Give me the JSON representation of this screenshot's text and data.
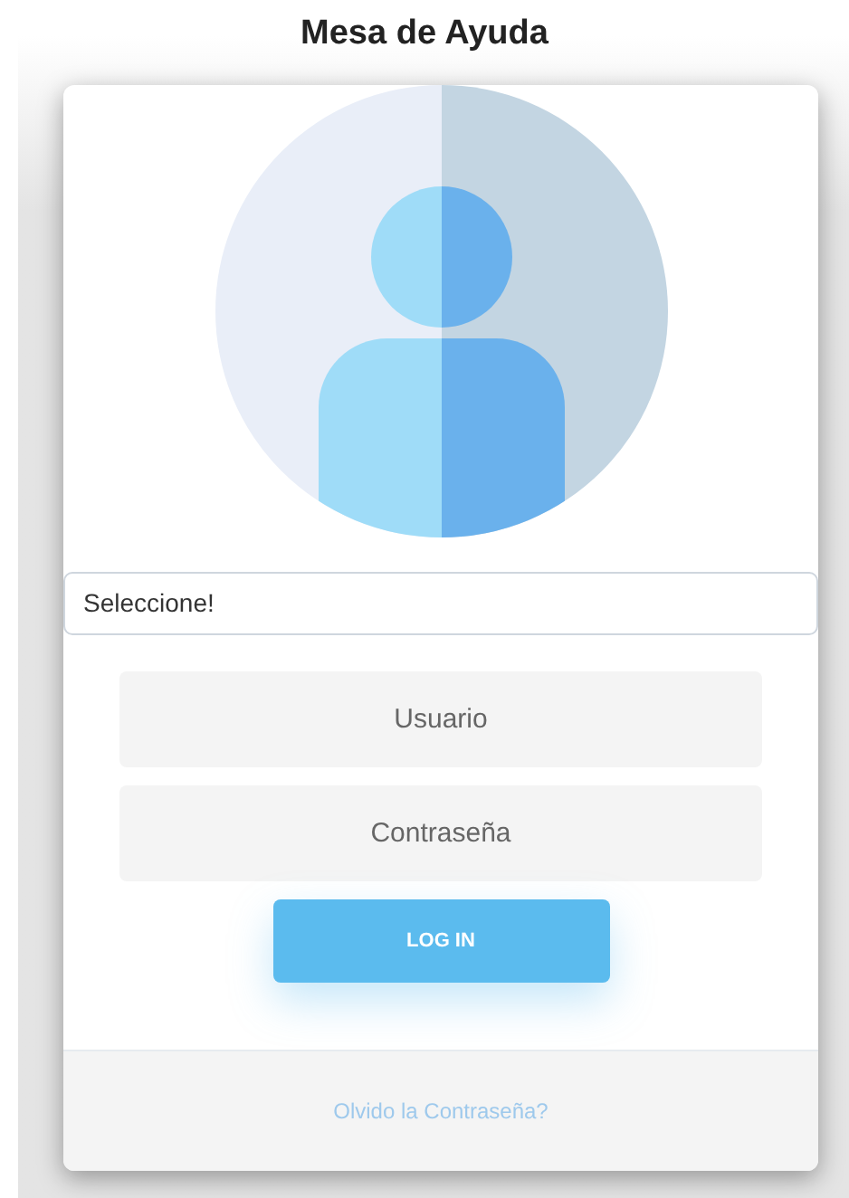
{
  "title": "Mesa de Ayuda",
  "select": {
    "value": "Seleccione!"
  },
  "fields": [
    {
      "placeholder": "Usuario"
    },
    {
      "placeholder": "Contraseña"
    }
  ],
  "button": "LOG IN",
  "footer_link": "Olvido la Contraseña?"
}
